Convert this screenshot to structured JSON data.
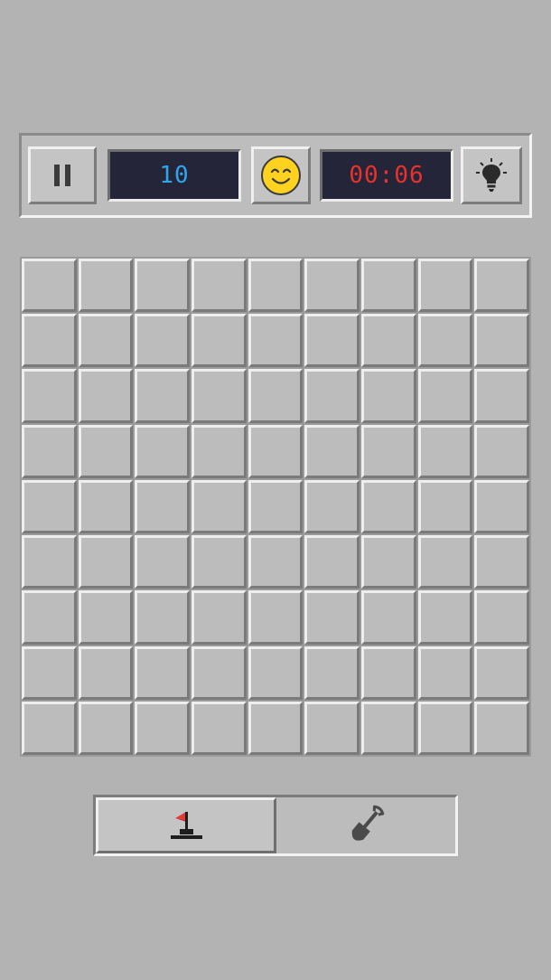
{
  "header": {
    "pause_icon": "pause-icon",
    "mine_counter": "10",
    "face_icon": "smiley-face-icon",
    "timer": "00:06",
    "hint_icon": "lightbulb-icon"
  },
  "board": {
    "rows": 9,
    "cols": 9,
    "state": "all-covered"
  },
  "mode_toggle": {
    "options": [
      {
        "icon": "flag-icon",
        "selected": true
      },
      {
        "icon": "shovel-icon",
        "selected": false
      }
    ]
  },
  "colors": {
    "background": "#b3b3b3",
    "display_bg": "#25253a",
    "counter_text": "#2fa6ec",
    "timer_text": "#e8322b",
    "flag_red": "#e53935",
    "face_yellow": "#ffd21f"
  }
}
